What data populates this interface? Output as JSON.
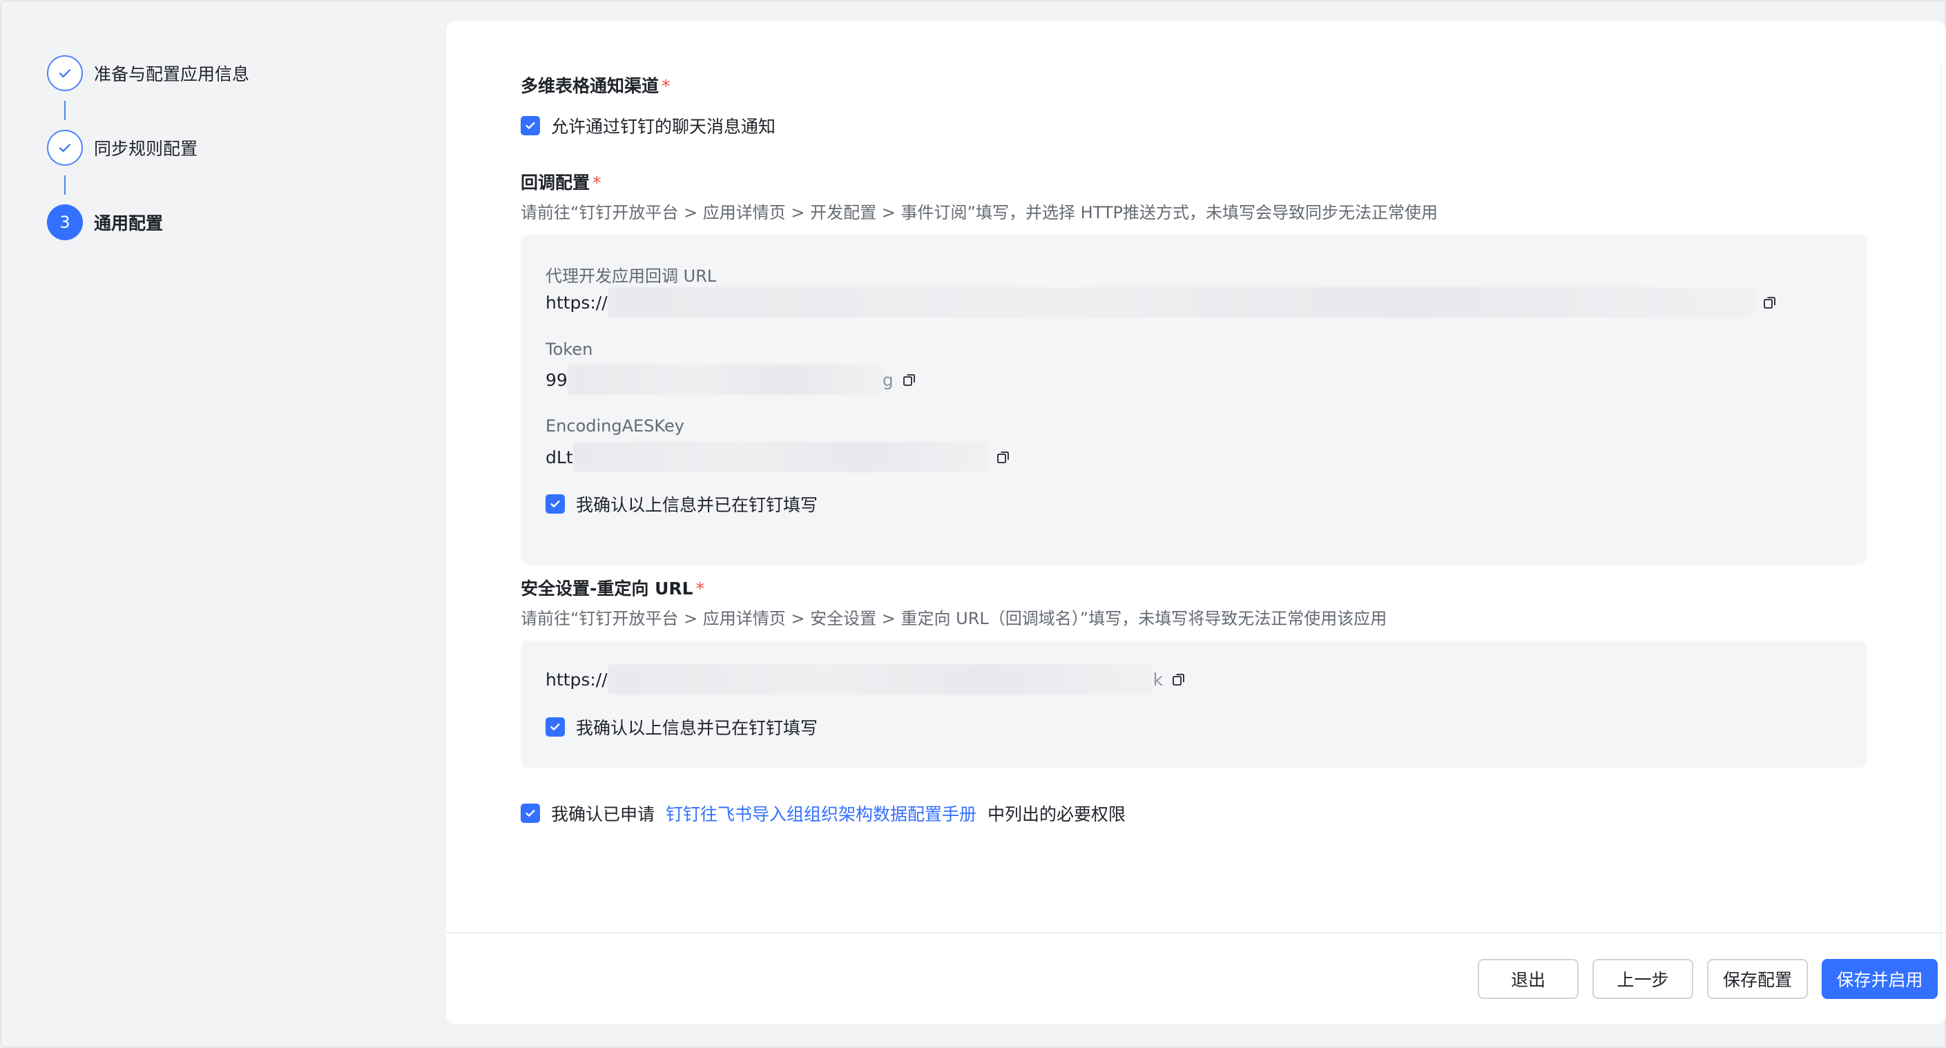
{
  "steps": [
    {
      "label": "准备与配置应用信息",
      "state": "done"
    },
    {
      "label": "同步规则配置",
      "state": "done"
    },
    {
      "label": "通用配置",
      "state": "active",
      "number": "3"
    }
  ],
  "notify": {
    "title": "多维表格通知渠道",
    "required_mark": "*",
    "checkbox_label": "允许通过钉钉的聊天消息通知",
    "checked": true
  },
  "callback": {
    "title": "回调配置",
    "required_mark": "*",
    "description": "请前往“钉钉开放平台 > 应用详情页 > 开发配置 > 事件订阅”填写，并选择 HTTP推送方式，未填写会导致同步无法正常使用",
    "fields": [
      {
        "label": "代理开发应用回调 URL",
        "value_prefix": "https://",
        "value_suffix": ""
      },
      {
        "label": "Token",
        "value_prefix": "99",
        "value_suffix": "g"
      },
      {
        "label": "EncodingAESKey",
        "value_prefix": "dLt",
        "value_suffix": ""
      }
    ],
    "confirm_label": "我确认以上信息并已在钉钉填写",
    "confirm_checked": true
  },
  "security": {
    "title": "安全设置-重定向 URL",
    "required_mark": "*",
    "description": "请前往“钉钉开放平台 > 应用详情页 > 安全设置 > 重定向 URL（回调域名）”填写，未填写将导致无法正常使用该应用",
    "value_prefix": "https://",
    "value_suffix": "k",
    "confirm_label": "我确认以上信息并已在钉钉填写",
    "confirm_checked": true
  },
  "permission": {
    "prefix": "我确认已申请",
    "link": "钉钉往飞书导入组组织架构数据配置手册",
    "suffix": "中列出的必要权限",
    "checked": true
  },
  "footer": {
    "exit": "退出",
    "prev": "上一步",
    "save": "保存配置",
    "save_enable": "保存并启用"
  },
  "colors": {
    "primary": "#3370ff",
    "required": "#f54a45",
    "panel_bg": "#f4f5f7"
  }
}
